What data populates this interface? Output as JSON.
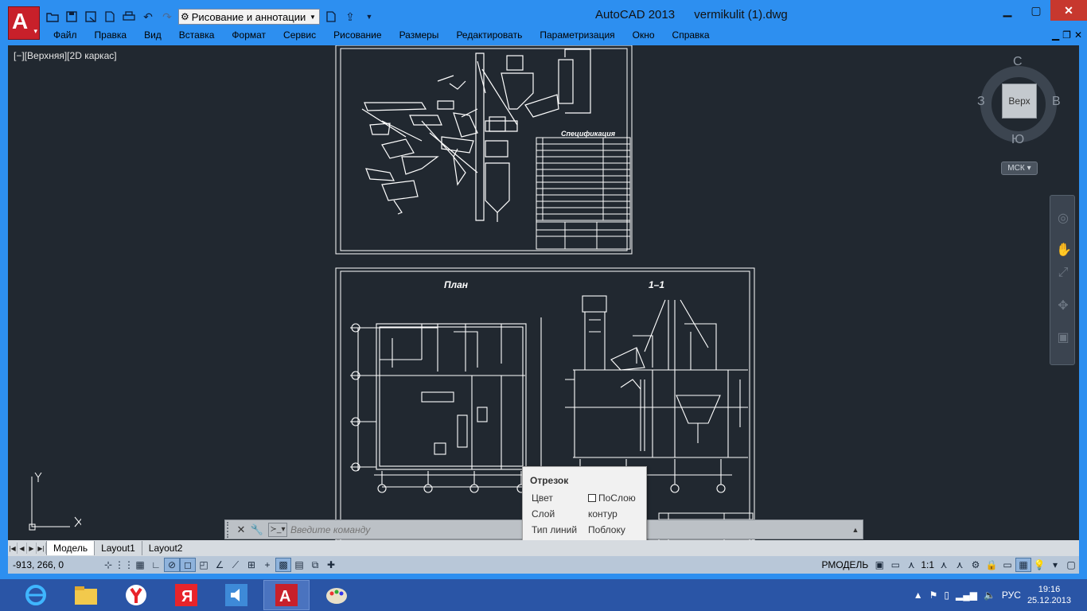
{
  "titlebar": {
    "app": "AutoCAD 2013",
    "file": "vermikulit (1).dwg",
    "workspace": "Рисование и аннотации"
  },
  "menu": [
    "Файл",
    "Правка",
    "Вид",
    "Вставка",
    "Формат",
    "Сервис",
    "Рисование",
    "Размеры",
    "Редактировать",
    "Параметризация",
    "Окно",
    "Справка"
  ],
  "viewport": {
    "label": "[−][Верхняя][2D каркас]"
  },
  "viewcube": {
    "face": "Верх",
    "north": "С",
    "south": "Ю",
    "west": "З",
    "east": "В",
    "ucs": "МСК"
  },
  "drawing": {
    "sheet2_title_plan": "План",
    "sheet2_title_section": "1–1",
    "spec_title": "Спецификация"
  },
  "command": {
    "placeholder": "Введите команду"
  },
  "tooltip": {
    "title": "Отрезок",
    "color_label": "Цвет",
    "color_value": "ПоСлою",
    "layer_label": "Слой",
    "layer_value": "контур",
    "linetype_label": "Тип линий",
    "linetype_value": "Поблоку"
  },
  "tabs": [
    "Модель",
    "Layout1",
    "Layout2"
  ],
  "status": {
    "coords": "-913, 266, 0",
    "space": "РМОДЕЛЬ",
    "scale": "1:1"
  },
  "clock": {
    "time": "19:16",
    "date": "25.12.2013"
  },
  "tray": {
    "lang": "РУС"
  },
  "colors": {
    "canvas": "#212830",
    "title": "#2d8ff0",
    "taskbar": "#2a55a6"
  }
}
